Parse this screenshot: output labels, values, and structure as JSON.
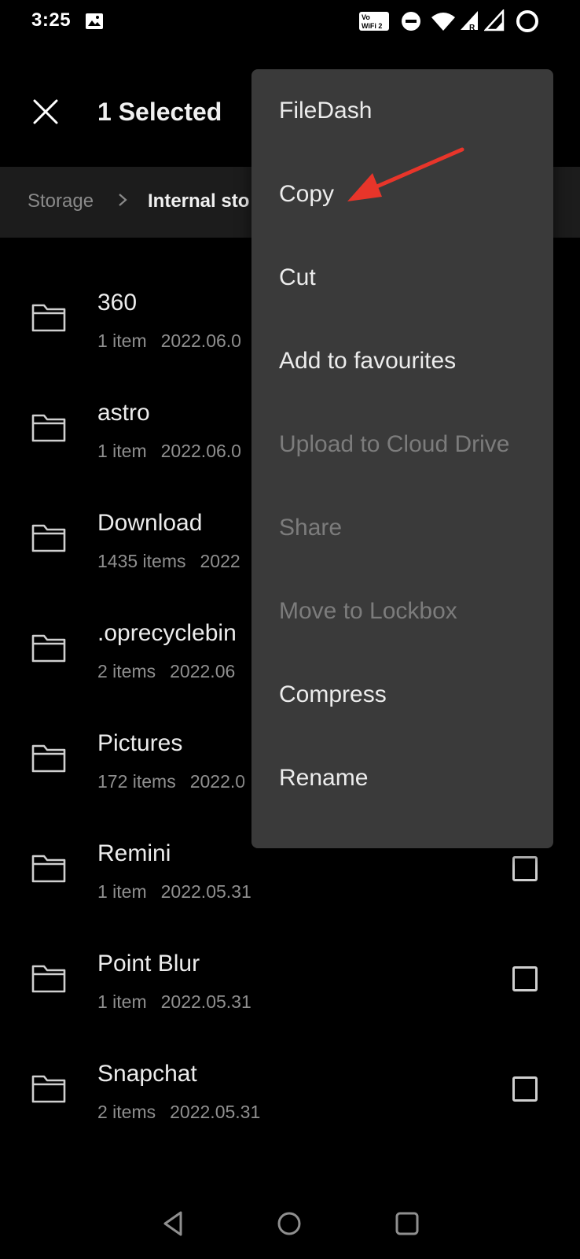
{
  "status_bar": {
    "time": "3:25",
    "icons": [
      "image-notification-icon",
      "vowifi-icon",
      "do-not-disturb-icon",
      "wifi-icon",
      "roaming-signal-icon",
      "signal-icon",
      "battery-icon"
    ],
    "vowifi_label": "Vo WiFi 2"
  },
  "app_bar": {
    "title": "1 Selected",
    "close_icon": "close-icon"
  },
  "breadcrumb": {
    "root": "Storage",
    "current": "Internal storage"
  },
  "files": [
    {
      "name": "360",
      "count": "1 item",
      "date": "2022.06.0"
    },
    {
      "name": "astro",
      "count": "1 item",
      "date": "2022.06.0"
    },
    {
      "name": "Download",
      "count": "1435 items",
      "date": "2022"
    },
    {
      "name": ".oprecyclebin",
      "count": "2 items",
      "date": "2022.06"
    },
    {
      "name": "Pictures",
      "count": "172 items",
      "date": "2022.0"
    },
    {
      "name": "Remini",
      "count": "1 item",
      "date": "2022.05.31"
    },
    {
      "name": "Point Blur",
      "count": "1 item",
      "date": "2022.05.31"
    },
    {
      "name": "Snapchat",
      "count": "2 items",
      "date": "2022.05.31"
    }
  ],
  "menu": {
    "items": [
      {
        "label": "FileDash",
        "enabled": true
      },
      {
        "label": "Copy",
        "enabled": true
      },
      {
        "label": "Cut",
        "enabled": true
      },
      {
        "label": "Add to favourites",
        "enabled": true
      },
      {
        "label": "Upload to Cloud Drive",
        "enabled": false
      },
      {
        "label": "Share",
        "enabled": false
      },
      {
        "label": "Move to Lockbox",
        "enabled": false
      },
      {
        "label": "Compress",
        "enabled": true
      },
      {
        "label": "Rename",
        "enabled": true
      }
    ]
  },
  "annotation": {
    "arrow_color": "#e8352a",
    "points_to": "Copy"
  },
  "colors": {
    "background": "#000000",
    "breadcrumb_bg": "#1c1c1c",
    "menu_bg": "#3a3a3a",
    "disabled_text": "#7c7c7c"
  },
  "nav_bar": {
    "icons": [
      "back-icon",
      "home-icon",
      "recents-icon"
    ]
  }
}
